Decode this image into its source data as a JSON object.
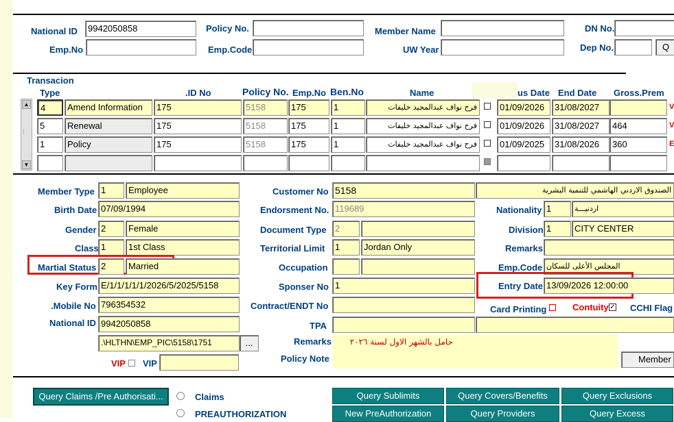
{
  "search": {
    "national_id_label": "National ID",
    "national_id_value": "9942050858",
    "policy_no_label": "Policy No.",
    "member_name_label": "Member Name",
    "dn_no_label": "DN No.",
    "emp_no_label": "Emp.No",
    "emp_code_label": "Emp.Code",
    "uw_year_label": "UW Year",
    "dep_no_label": "Dep No.",
    "query_btn": "Q"
  },
  "transactions": {
    "section_title": "Transacion",
    "headers": {
      "type": "Type",
      "id_no": ".ID No",
      "policy_no": "Policy No.",
      "emp_no": "Emp.No",
      "ben_no": "Ben.No",
      "name": "Name",
      "from_date": "us Date",
      "end_date": "End Date",
      "gross_prem": "Gross.Prem"
    },
    "rows": [
      {
        "type_no": "4",
        "type_name": "Amend Information",
        "id_no": "175",
        "policy_no": "5158",
        "emp_no": "175",
        "ben_no": "1",
        "name": "فرح نواف عبدالمجيد خليفات",
        "from_date": "01/09/2026",
        "end_date": "31/08/2027",
        "gross_prem": "",
        "mark": "V"
      },
      {
        "type_no": "5",
        "type_name": "Renewal",
        "id_no": "175",
        "policy_no": "5158",
        "emp_no": "175",
        "ben_no": "1",
        "name": "فرح نواف عبدالمجيد خليفات",
        "from_date": "01/09/2026",
        "end_date": "31/08/2027",
        "gross_prem": "464",
        "mark": "V"
      },
      {
        "type_no": "1",
        "type_name": "Policy",
        "id_no": "175",
        "policy_no": "5158",
        "emp_no": "175",
        "ben_no": "1",
        "name": "فرح نواف عبدالمجيد خليفات",
        "from_date": "01/09/2025",
        "end_date": "31/08/2026",
        "gross_prem": "360",
        "mark": "E"
      }
    ]
  },
  "member": {
    "member_type_label": "Member Type",
    "member_type_code": "1",
    "member_type_name": "Employee",
    "birth_date_label": "Birth Date",
    "birth_date": "07/09/1994",
    "gender_label": "Gender",
    "gender_code": "2",
    "gender_name": "Female",
    "class_label": "Class",
    "class_code": "1",
    "class_name": "1st Class",
    "marital_label": "Martial Status",
    "marital_code": "2",
    "marital_name": "Married",
    "key_form_label": "Key Form",
    "key_form": "E/1/1/1/1/1/2026/5/2025/5158",
    "mobile_label": ".Mobile No",
    "mobile": "796354532",
    "national_id_label": "National ID",
    "national_id": "9942050858",
    "pic_path": ".\\HLTHN\\EMP_PIC\\5158\\1751",
    "browse_btn": "...",
    "vip_red_label": "VIP",
    "vip_label": "VIP"
  },
  "customer": {
    "customer_no_label": "Customer No",
    "customer_no": "5158",
    "customer_name": "الصندوق الاردني الهاشمي للتنمية البشرية",
    "endorsement_label": "Endorsment No.",
    "endorsement_no": "119689",
    "document_type_label": "Document Type",
    "document_type": "2",
    "territorial_label": "Territorial Limit",
    "territorial_code": "1",
    "territorial_name": "Jordan Only",
    "occupation_label": "Occupation",
    "sponser_label": "Sponser No",
    "sponser_no": "1",
    "contract_label": "Contract/ENDT No",
    "tpa_label": "TPA",
    "remarks_label": "Remarks",
    "remarks_text": "حامل بالشهر الاول لسنة ٢٠٢٦",
    "policy_note_label": "Policy Note"
  },
  "right": {
    "nationality_label": "Nationality",
    "nationality_code": "1",
    "nationality_name": "اردنيـــة",
    "division_label": "Division",
    "division_code": "1",
    "division_name": "CITY CENTER",
    "remarks_label": "Remarks",
    "emp_code_label": "Emp.Code",
    "emp_code_value": "المجلس الأعلى للسكان",
    "entry_date_label": "Entry Date",
    "entry_date": "13/09/2026 12:00:00",
    "card_printing_label": "Card Printing",
    "contuity_label": "Contuity",
    "cchi_label": "CCHI Flag",
    "member_btn": "Member I"
  },
  "bottom": {
    "query_claims_btn": "Query Claims /Pre Authorisati...",
    "claims_radio": "Claims",
    "preauth_radio": "PREAUTHORIZATION",
    "query_sublimits": "Query Sublimits",
    "query_covers": "Query Covers/Benefits",
    "query_exclusions": "Query Exclusions",
    "new_preauth": "New PreAuthorization",
    "query_providers": "Query Providers",
    "query_excess": "Query Excess"
  },
  "colors": {
    "label_blue": "#003f7f",
    "field_yellow": "#ffffc4",
    "button_teal": "#0f7e7e",
    "highlight_red": "#d42020"
  }
}
